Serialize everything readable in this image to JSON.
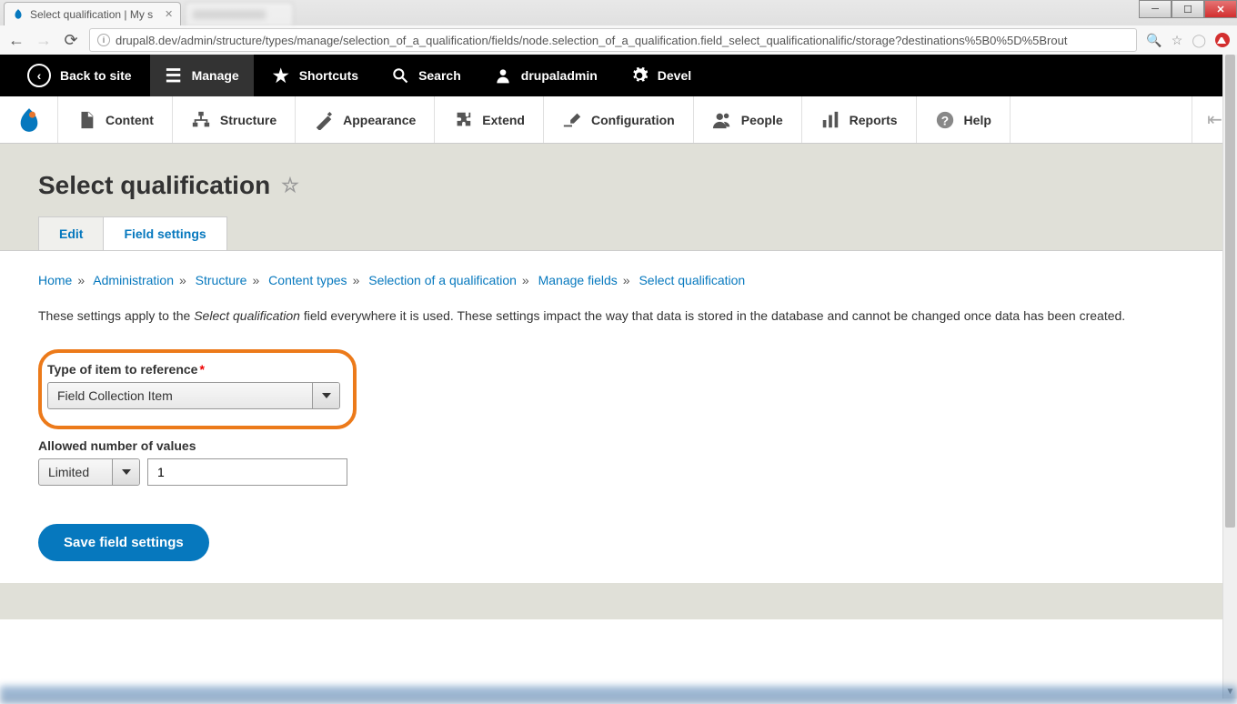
{
  "browser": {
    "tab_title": "Select qualification | My s",
    "url": "drupal8.dev/admin/structure/types/manage/selection_of_a_qualification/fields/node.selection_of_a_qualification.field_select_qualificationalific/storage?destinations%5B0%5D%5Brout"
  },
  "toolbar": {
    "back_to_site": "Back to site",
    "manage": "Manage",
    "shortcuts": "Shortcuts",
    "search": "Search",
    "user": "drupaladmin",
    "devel": "Devel"
  },
  "secondary": {
    "content": "Content",
    "structure": "Structure",
    "appearance": "Appearance",
    "extend": "Extend",
    "configuration": "Configuration",
    "people": "People",
    "reports": "Reports",
    "help": "Help"
  },
  "page": {
    "title": "Select qualification",
    "tabs": {
      "edit": "Edit",
      "field_settings": "Field settings"
    }
  },
  "breadcrumbs": {
    "home": "Home",
    "administration": "Administration",
    "structure": "Structure",
    "content_types": "Content types",
    "selection": "Selection of a qualification",
    "manage_fields": "Manage fields",
    "current": "Select qualification"
  },
  "description": {
    "pre": "These settings apply to the ",
    "em": "Select qualification",
    "post": " field everywhere it is used. These settings impact the way that data is stored in the database and cannot be changed once data has been created."
  },
  "form": {
    "type_label": "Type of item to reference",
    "type_value": "Field Collection Item",
    "allowed_label": "Allowed number of values",
    "allowed_select": "Limited",
    "allowed_number": "1",
    "save_button": "Save field settings"
  }
}
